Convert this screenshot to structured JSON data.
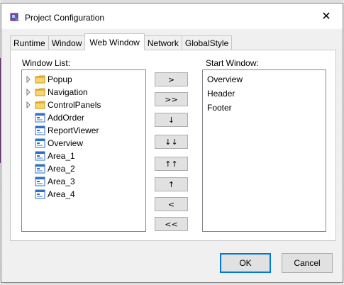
{
  "dialog": {
    "title": "Project Configuration",
    "close_glyph": "✕"
  },
  "tabs": [
    {
      "label": "Runtime",
      "active": false
    },
    {
      "label": "Window",
      "active": false
    },
    {
      "label": "Web Window",
      "active": true
    },
    {
      "label": "Network",
      "active": false
    },
    {
      "label": "GlobalStyle",
      "active": false
    }
  ],
  "window_list": {
    "label": "Window List:",
    "items": [
      {
        "label": "Popup",
        "type": "folder",
        "icon": "folder-icon"
      },
      {
        "label": "Navigation",
        "type": "folder",
        "icon": "folder-icon"
      },
      {
        "label": "ControlPanels",
        "type": "folder",
        "icon": "folder-icon"
      },
      {
        "label": "AddOrder",
        "type": "window",
        "icon": "window-icon"
      },
      {
        "label": "ReportViewer",
        "type": "window",
        "icon": "window-icon"
      },
      {
        "label": "Overview",
        "type": "window",
        "icon": "window-icon"
      },
      {
        "label": "Area_1",
        "type": "window",
        "icon": "window-icon"
      },
      {
        "label": "Area_2",
        "type": "window",
        "icon": "window-icon"
      },
      {
        "label": "Area_3",
        "type": "window",
        "icon": "window-icon"
      },
      {
        "label": "Area_4",
        "type": "window",
        "icon": "window-icon"
      }
    ]
  },
  "start_window": {
    "label": "Start Window:",
    "items": [
      "Overview",
      "Header",
      "Footer"
    ]
  },
  "transfer_buttons": {
    "add": ">",
    "add_all": ">>",
    "move_down": "↓",
    "move_bottom": "↓↓",
    "move_top": "↑↑",
    "move_up": "↑",
    "remove": "<",
    "remove_all": "<<"
  },
  "footer": {
    "ok_label": "OK",
    "cancel_label": "Cancel"
  },
  "colors": {
    "folder": "#f5c242",
    "window_icon": "#2f6fc7",
    "accent": "#0078d7"
  }
}
